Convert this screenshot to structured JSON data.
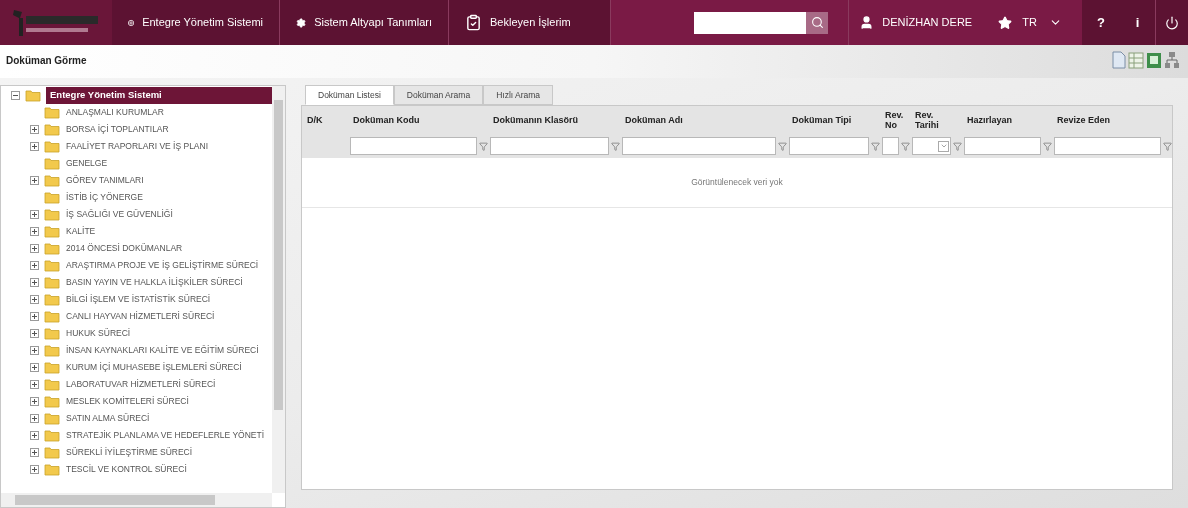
{
  "header": {
    "nav": [
      {
        "label": "Entegre Yönetim Sistemi",
        "kind": "system"
      },
      {
        "label": "Sistem Altyapı Tanımları",
        "kind": "settings"
      },
      {
        "label": "Bekleyen İşlerim",
        "kind": "tasks"
      }
    ],
    "user": "DENİZHAN DERE",
    "language": "TR",
    "help": "?",
    "info": "i"
  },
  "page_title": "Doküman Görme",
  "tree": {
    "label": "Entegre Yönetim Sistemi",
    "expanded": true,
    "selected": true,
    "children": [
      {
        "label": "ANLAŞMALI KURUMLAR",
        "selected": false
      },
      {
        "label": "BORSA İÇİ TOPLANTILAR",
        "expanded": false,
        "selected": false
      },
      {
        "label": "FAALİYET RAPORLARI VE İŞ PLANI",
        "expanded": false,
        "selected": false
      },
      {
        "label": "GENELGE",
        "selected": false
      },
      {
        "label": "GÖREV TANIMLARI",
        "expanded": false,
        "selected": false
      },
      {
        "label": "İSTİB İÇ YÖNERGE",
        "selected": false
      },
      {
        "label": "İŞ SAĞLIĞI VE GÜVENLİĞİ",
        "expanded": false,
        "selected": false
      },
      {
        "label": "KALİTE",
        "expanded": false,
        "selected": false
      },
      {
        "label": "2014 ÖNCESİ DOKÜMANLAR",
        "expanded": false,
        "selected": false
      },
      {
        "label": "ARAŞTIRMA PROJE VE İŞ GELİŞTİRME SÜRECİ",
        "expanded": false,
        "selected": false
      },
      {
        "label": "BASIN YAYIN VE HALKLA İLİŞKİLER SÜRECİ",
        "expanded": false,
        "selected": false
      },
      {
        "label": "BİLGİ İŞLEM VE İSTATİSTİK SÜRECİ",
        "expanded": false,
        "selected": false
      },
      {
        "label": "CANLI HAYVAN HİZMETLERİ SÜRECİ",
        "expanded": false,
        "selected": false
      },
      {
        "label": "HUKUK SÜRECİ",
        "expanded": false,
        "selected": false
      },
      {
        "label": "İNSAN KAYNAKLARI KALİTE VE EĞİTİM SÜRECİ",
        "expanded": false,
        "selected": false
      },
      {
        "label": "KURUM İÇİ MUHASEBE İŞLEMLERİ SÜRECİ",
        "expanded": false,
        "selected": false
      },
      {
        "label": "LABORATUVAR HİZMETLERİ SÜRECİ",
        "expanded": false,
        "selected": false
      },
      {
        "label": "MESLEK KOMİTELERİ SÜRECİ",
        "expanded": false,
        "selected": false
      },
      {
        "label": "SATIN ALMA SÜRECİ",
        "expanded": false,
        "selected": false
      },
      {
        "label": "STRATEJİK PLANLAMA VE HEDEFLERLE YÖNETİ",
        "expanded": false,
        "selected": false
      },
      {
        "label": "SÜREKLİ İYİLEŞTİRME SÜRECİ",
        "expanded": false,
        "selected": false
      },
      {
        "label": "TESCİL VE KONTROL SÜRECİ",
        "expanded": false,
        "selected": false
      }
    ]
  },
  "tabs": [
    {
      "label": "Doküman Listesi",
      "selected": true
    },
    {
      "label": "Doküman Arama",
      "selected": false
    },
    {
      "label": "Hızlı Arama",
      "selected": false
    }
  ],
  "table": {
    "columns": [
      {
        "label": "D/K",
        "kind": "plain"
      },
      {
        "label": "Doküman Kodu",
        "kind": "text_filter"
      },
      {
        "label": "Dokümanın Klasörü",
        "kind": "text_filter"
      },
      {
        "label": "Doküman Adı",
        "kind": "text_filter"
      },
      {
        "label": "Doküman Tipi",
        "kind": "text_filter"
      },
      {
        "label": "Rev. No",
        "kind": "text_filter"
      },
      {
        "label": "Rev. Tarihi",
        "kind": "date_filter"
      },
      {
        "label": "Hazırlayan",
        "kind": "text_filter"
      },
      {
        "label": "Revize Eden",
        "kind": "text_filter"
      }
    ],
    "empty_message": "Görüntülenecek veri yok"
  }
}
